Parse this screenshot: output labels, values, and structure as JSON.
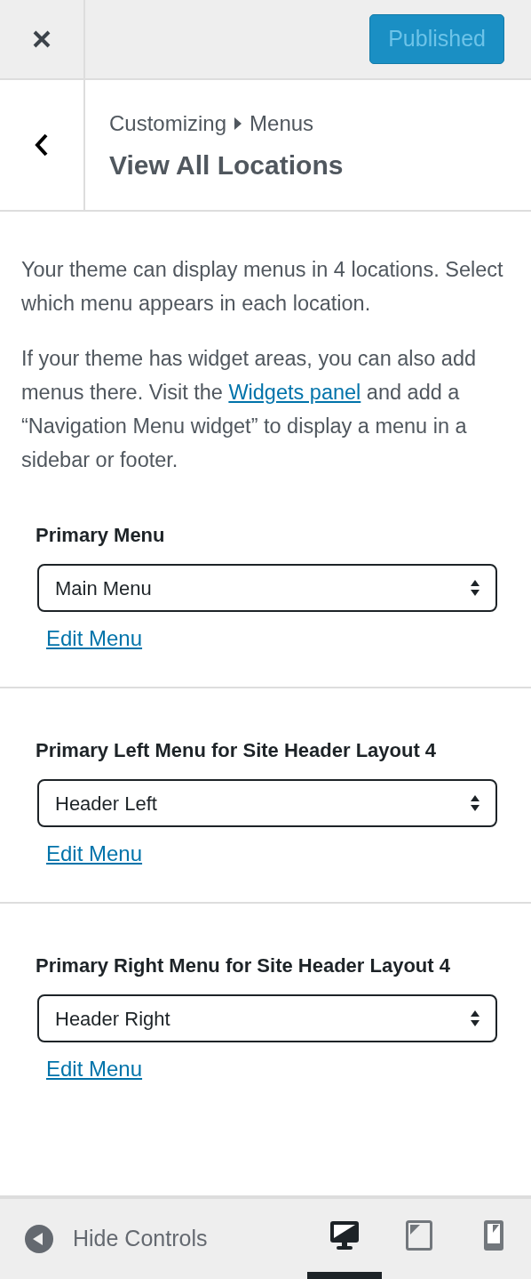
{
  "top_bar": {
    "publish_button": "Published"
  },
  "header": {
    "breadcrumb": [
      "Customizing",
      "Menus"
    ],
    "title": "View All Locations"
  },
  "intro": [
    "Your theme can display menus in 4 locations. Select which menu appears in each location."
  ],
  "intro_widgets": {
    "before": "If your theme has widget areas, you can also add menus there. Visit the",
    "link": "Widgets panel",
    "after": "and add a “Navigation Menu widget” to display a menu in a sidebar or footer."
  },
  "locations": [
    {
      "label": "Primary Menu",
      "value": "Main Menu",
      "link": "Edit Menu"
    },
    {
      "label": "Primary Left Menu for Site Header Layout 4",
      "value": "Header Left",
      "link": "Edit Menu"
    },
    {
      "label": "Primary Right Menu for Site Header Layout 4",
      "value": "Header Right",
      "link": "Edit Menu"
    }
  ],
  "footer": {
    "hide_controls": "Hide Controls",
    "devices": [
      {
        "kind": "desktop",
        "selected": true
      },
      {
        "kind": "tablet",
        "selected": false
      },
      {
        "kind": "mobile",
        "selected": false
      }
    ]
  }
}
